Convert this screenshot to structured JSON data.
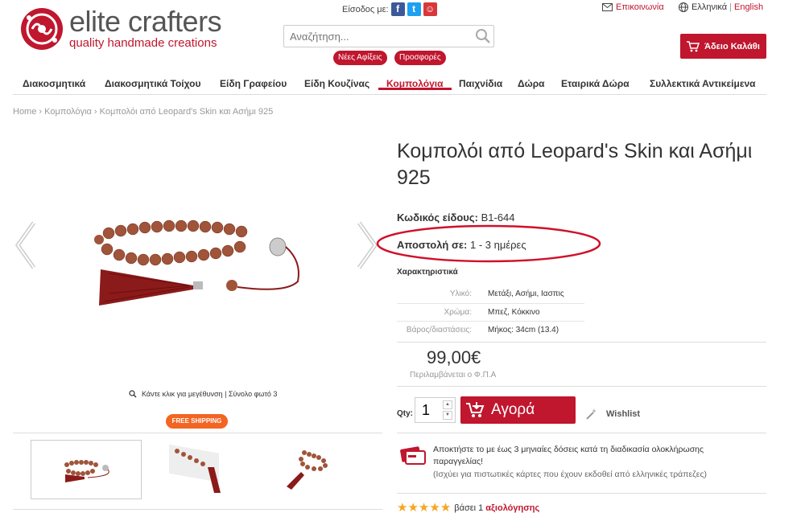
{
  "header": {
    "brand_name": "elite crafters",
    "brand_tagline": "quality handmade creations",
    "login_label": "Είσοδος με:",
    "contact_label": "Επικοινωνία",
    "lang_current": "Ελληνικά",
    "lang_alt": "English",
    "search_placeholder": "Αναζήτηση...",
    "pill_new": "Νέες Αφίξεις",
    "pill_offers": "Προσφορές",
    "cart_label": "Άδειο Καλάθι",
    "brand_color": "#c0162e"
  },
  "nav": {
    "items": [
      {
        "label": "Διακοσμητικά"
      },
      {
        "label": "Διακοσμητικά Τοίχου"
      },
      {
        "label": "Είδη Γραφείου"
      },
      {
        "label": "Είδη Κουζίνας"
      },
      {
        "label": "Κομπολόγια"
      },
      {
        "label": "Παιχνίδια"
      },
      {
        "label": "Δώρα"
      },
      {
        "label": "Εταιρικά Δώρα"
      },
      {
        "label": "Συλλεκτικά Αντικείμενα"
      }
    ],
    "active_index": 4
  },
  "breadcrumb": "Home › Κομπολόγια › Κομπολόι από Leopard's Skin και Ασήμι 925",
  "gallery": {
    "zoom_note": "Κάντε κλικ για μεγέθυνση | Σύνολο φωτό 3",
    "free_shipping": "FREE SHIPPING",
    "thumb_count": 3
  },
  "product": {
    "title": "Κομπολόι από Leopard's Skin και Ασήμι 925",
    "sku_label": "Κωδικός είδους:",
    "sku_value": "B1-644",
    "ship_label": "Αποστολή σε:",
    "ship_value": "1 - 3 ημέρες",
    "features_title": "Χαρακτηριστικά",
    "specs": [
      {
        "key": "Υλικό:",
        "value": "Μετάξι, Ασήμι, Ιασπις"
      },
      {
        "key": "Χρώμα:",
        "value": "Μπεζ, Κόκκινο"
      },
      {
        "key": "Βάρος/διαστάσεις:",
        "value": "Μήκος: 34cm (13.4)"
      }
    ],
    "price": "99,00€",
    "vat_note": "Περιλαμβάνεται ο Φ.Π.Α",
    "qty_label": "Qty:",
    "qty_value": "1",
    "buy_label": "Αγορά",
    "wishlist_label": "Wishlist",
    "installments_text": "Αποκτήστε το με έως 3 μηνιαίες δόσεις κατά τη διαδικασία ολοκλήρωσης παραγγελίας!",
    "installments_note": "(Ισχύει για πιστωτικές κάρτες που έχουν εκδοθεί από ελληνικές τράπεζες)",
    "rating_stars": 5,
    "rating_text": "βάσει 1",
    "rating_link": "αξιολόγησης"
  }
}
